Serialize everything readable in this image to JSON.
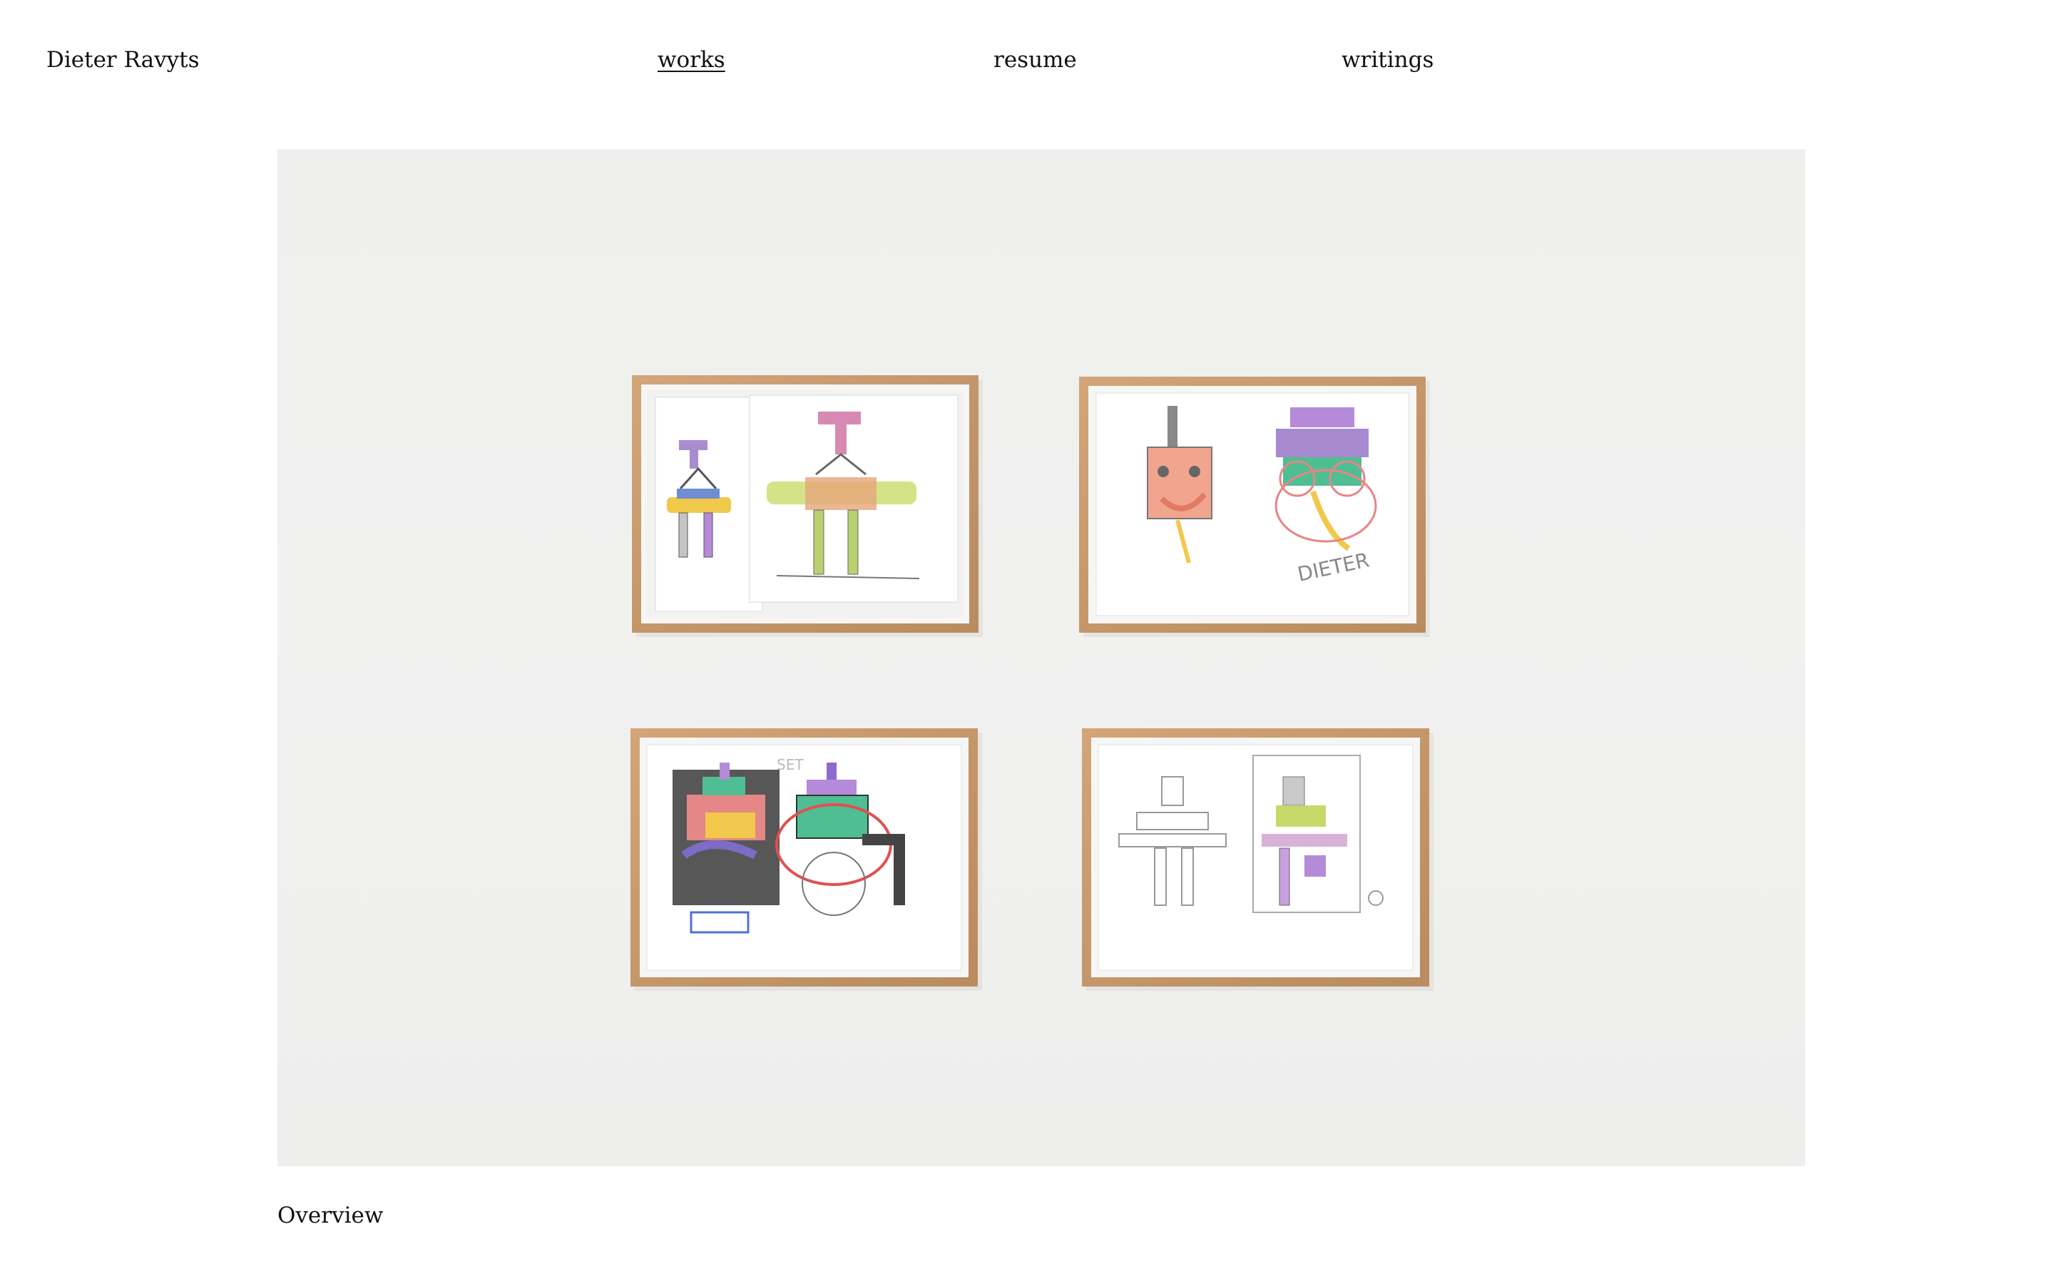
{
  "header": {
    "site_title": "Dieter Ravyts",
    "nav": {
      "works": "works",
      "resume": "resume",
      "writings": "writings"
    },
    "active_nav": "works"
  },
  "artwork": {
    "caption": "Overview",
    "sketch_text": {
      "frame2_signature": "DIETER",
      "frame3_note": "SET"
    }
  },
  "colors": {
    "text": "#111111",
    "background": "#ffffff",
    "wall": "#efefee",
    "frame_wood": "#c79a6c"
  }
}
